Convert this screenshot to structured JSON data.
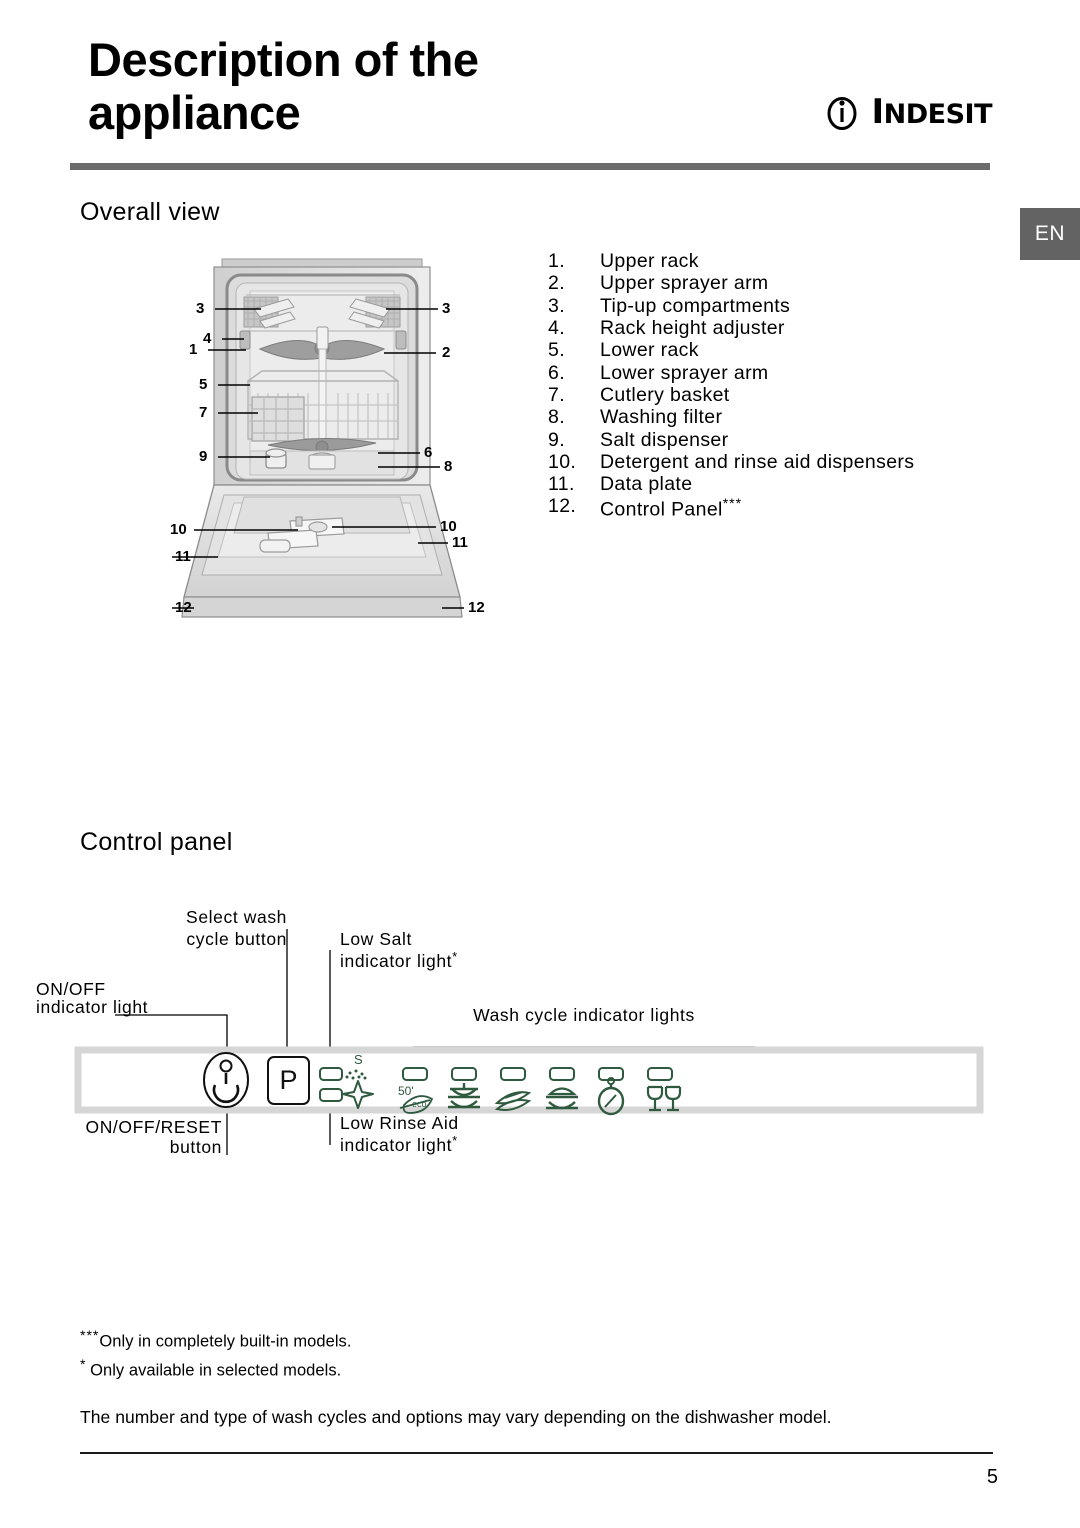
{
  "header": {
    "title_line1": "Description of the",
    "title_line2": "appliance",
    "logo_text_i": "i",
    "logo_text": "INDESIT"
  },
  "language_tab": {
    "label": "EN"
  },
  "sections": {
    "overall_view_heading": "Overall view",
    "control_panel_heading": "Control panel"
  },
  "parts_list": [
    {
      "number": "1.",
      "label": "Upper rack"
    },
    {
      "number": "2.",
      "label": "Upper sprayer arm"
    },
    {
      "number": "3.",
      "label": "Tip-up compartments"
    },
    {
      "number": "4.",
      "label": "Rack height adjuster"
    },
    {
      "number": "5.",
      "label": "Lower rack"
    },
    {
      "number": "6.",
      "label": "Lower sprayer arm"
    },
    {
      "number": "7.",
      "label": "Cutlery basket"
    },
    {
      "number": "8.",
      "label": "Washing filter"
    },
    {
      "number": "9.",
      "label": "Salt dispenser"
    },
    {
      "number": "10.",
      "label": "Detergent and rinse aid dispensers"
    },
    {
      "number": "11.",
      "label": "Data plate"
    },
    {
      "number": "12.",
      "label": "Control Panel",
      "superscript": "***"
    }
  ],
  "diagram_callouts": {
    "left": [
      "3",
      "4",
      "1",
      "5",
      "7",
      "9",
      "10",
      "11",
      "12"
    ],
    "right": [
      "3",
      "2",
      "6",
      "8",
      "10",
      "11",
      "12"
    ]
  },
  "control_panel": {
    "labels": {
      "select_wash_cycle_line1": "Select wash",
      "select_wash_cycle_line2": "cycle button",
      "low_salt_line1": "Low Salt",
      "low_salt_line2": "indicator light",
      "low_salt_star": "*",
      "on_off_indicator_line1": "ON/OFF",
      "on_off_indicator_line2": "indicator light",
      "wash_cycle_indicator_lights": "Wash cycle indicator lights",
      "on_off_reset_line1": "ON/OFF/RESET",
      "on_off_reset_line2": "button",
      "low_rinse_aid_line1": "Low Rinse Aid",
      "low_rinse_aid_line2": "indicator light",
      "low_rinse_aid_star": "*"
    },
    "select_button_label": "P",
    "salt_icon_letter": "S",
    "eco_icon_label": "50°",
    "accent_color": "#2f5a3f",
    "panel_border_color": "#d6d6d6",
    "cycle_icons": [
      "eco-50-leaf-icon",
      "pot-lid-icon",
      "plates-icon",
      "bowl-lid-icon",
      "timer-stopwatch-icon",
      "glasses-icon"
    ],
    "option_icons": [
      "low-salt-icon",
      "low-rinse-aid-sparkle-icon"
    ]
  },
  "footnotes": {
    "triple_star": "***",
    "triple_star_text": "Only in completely built-in models.",
    "single_star": "*",
    "single_star_text": " Only available in selected models.",
    "general": "The number and type of wash cycles and options may vary depending on the dishwasher model."
  },
  "footer": {
    "page_number": "5"
  }
}
